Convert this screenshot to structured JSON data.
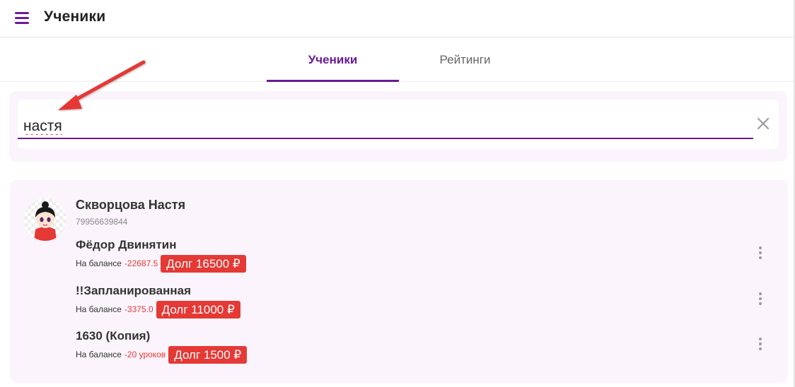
{
  "header": {
    "title": "Ученики",
    "menu_icon": "hamburger-menu-icon"
  },
  "tabs": [
    {
      "label": "Ученики",
      "active": true
    },
    {
      "label": "Рейтинги",
      "active": false
    }
  ],
  "search": {
    "value": "настя",
    "clear_icon": "close-icon"
  },
  "student": {
    "name": "Скворцова Настя",
    "phone": "79956639844",
    "groups": [
      {
        "name": "Фёдор Двинятин",
        "balance_label": "На балансе",
        "balance_value": "-22687.5",
        "debt": "Долг  16500 ₽"
      },
      {
        "name": "!!Запланированная",
        "balance_label": "На балансе",
        "balance_value": "-3375.0",
        "debt": "Долг  11000 ₽"
      },
      {
        "name": "1630 (Копия)",
        "balance_label": "На балансе",
        "balance_value": "-20 уроков",
        "debt": "Долг  1500 ₽"
      }
    ]
  },
  "colors": {
    "accent": "#6a1b9a",
    "debt": "#e53935",
    "panel": "#fbf4fc"
  }
}
